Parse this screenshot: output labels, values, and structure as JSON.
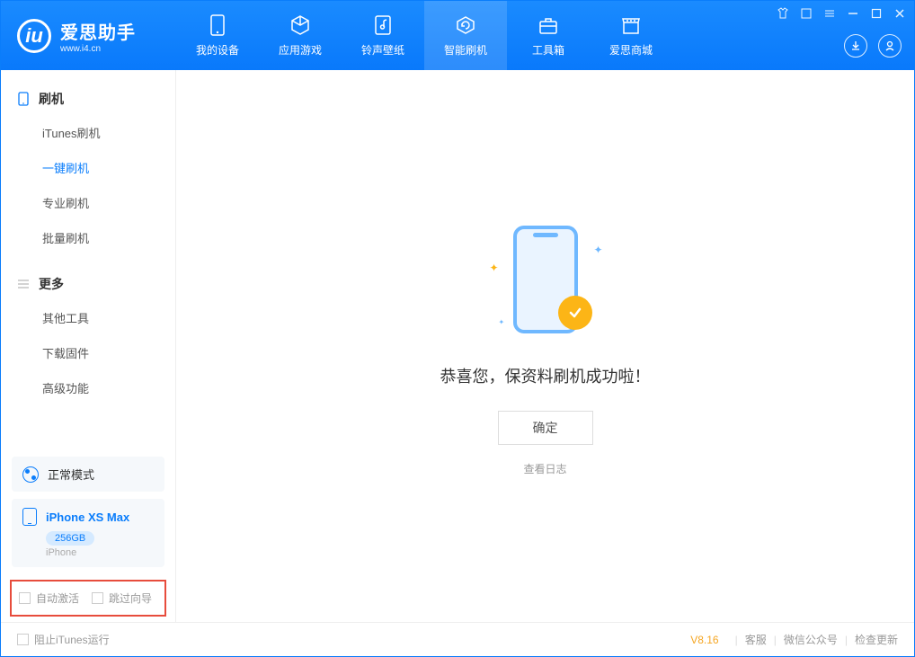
{
  "app": {
    "title": "爱思助手",
    "site": "www.i4.cn"
  },
  "nav": [
    {
      "label": "我的设备",
      "icon": "device"
    },
    {
      "label": "应用游戏",
      "icon": "cube"
    },
    {
      "label": "铃声壁纸",
      "icon": "music"
    },
    {
      "label": "智能刷机",
      "icon": "refresh"
    },
    {
      "label": "工具箱",
      "icon": "briefcase"
    },
    {
      "label": "爱思商城",
      "icon": "store"
    }
  ],
  "sidebar": {
    "section1": {
      "title": "刷机",
      "items": [
        "iTunes刷机",
        "一键刷机",
        "专业刷机",
        "批量刷机"
      ]
    },
    "section2": {
      "title": "更多",
      "items": [
        "其他工具",
        "下载固件",
        "高级功能"
      ]
    },
    "active": "一键刷机"
  },
  "mode": {
    "label": "正常模式"
  },
  "device": {
    "name": "iPhone XS Max",
    "capacity": "256GB",
    "type": "iPhone"
  },
  "options": {
    "auto_activate": "自动激活",
    "skip_wizard": "跳过向导"
  },
  "main": {
    "success_msg": "恭喜您，保资料刷机成功啦！",
    "confirm": "确定",
    "view_log": "查看日志"
  },
  "footer": {
    "block_itunes": "阻止iTunes运行",
    "version": "V8.16",
    "links": [
      "客服",
      "微信公众号",
      "检查更新"
    ]
  }
}
